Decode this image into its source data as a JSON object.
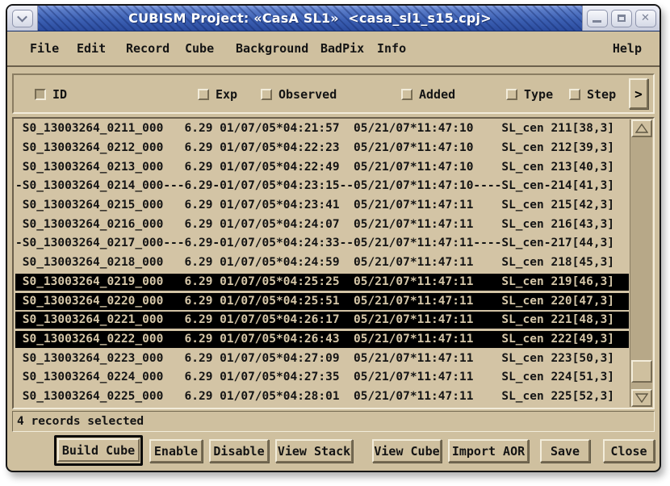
{
  "window": {
    "title": "CUBISM Project: «CasA SL1»  <casa_sl1_s15.cpj>"
  },
  "menubar": {
    "items": [
      "File",
      "Edit",
      "Record",
      "Cube",
      "Background",
      "BadPix",
      "Info"
    ],
    "help": "Help"
  },
  "header": {
    "columns": [
      {
        "label": "ID",
        "checked": true
      },
      {
        "label": "Exp",
        "checked": false
      },
      {
        "label": "Observed",
        "checked": false
      },
      {
        "label": "Added",
        "checked": false
      },
      {
        "label": "Type",
        "checked": false
      },
      {
        "label": "Step",
        "checked": false
      }
    ],
    "more_label": ">"
  },
  "list": {
    "rows": [
      {
        "id": "S0_13003264_0211_000",
        "exp": "6.29",
        "observed": "01/07/05*04:21:57",
        "added": "05/21/07*11:47:10",
        "type": "SL_cen",
        "step": "211[38,3]",
        "state": "normal"
      },
      {
        "id": "S0_13003264_0212_000",
        "exp": "6.29",
        "observed": "01/07/05*04:22:23",
        "added": "05/21/07*11:47:10",
        "type": "SL_cen",
        "step": "212[39,3]",
        "state": "normal"
      },
      {
        "id": "S0_13003264_0213_000",
        "exp": "6.29",
        "observed": "01/07/05*04:22:49",
        "added": "05/21/07*11:47:10",
        "type": "SL_cen",
        "step": "213[40,3]",
        "state": "normal"
      },
      {
        "id": "S0_13003264_0214_000",
        "exp": "6.29",
        "observed": "01/07/05*04:23:15",
        "added": "05/21/07*11:47:10",
        "type": "SL_cen",
        "step": "214[41,3]",
        "state": "disabled"
      },
      {
        "id": "S0_13003264_0215_000",
        "exp": "6.29",
        "observed": "01/07/05*04:23:41",
        "added": "05/21/07*11:47:11",
        "type": "SL_cen",
        "step": "215[42,3]",
        "state": "normal"
      },
      {
        "id": "S0_13003264_0216_000",
        "exp": "6.29",
        "observed": "01/07/05*04:24:07",
        "added": "05/21/07*11:47:11",
        "type": "SL_cen",
        "step": "216[43,3]",
        "state": "normal"
      },
      {
        "id": "S0_13003264_0217_000",
        "exp": "6.29",
        "observed": "01/07/05*04:24:33",
        "added": "05/21/07*11:47:11",
        "type": "SL_cen",
        "step": "217[44,3]",
        "state": "disabled"
      },
      {
        "id": "S0_13003264_0218_000",
        "exp": "6.29",
        "observed": "01/07/05*04:24:59",
        "added": "05/21/07*11:47:11",
        "type": "SL_cen",
        "step": "218[45,3]",
        "state": "normal"
      },
      {
        "id": "S0_13003264_0219_000",
        "exp": "6.29",
        "observed": "01/07/05*04:25:25",
        "added": "05/21/07*11:47:11",
        "type": "SL_cen",
        "step": "219[46,3]",
        "state": "selected"
      },
      {
        "id": "S0_13003264_0220_000",
        "exp": "6.29",
        "observed": "01/07/05*04:25:51",
        "added": "05/21/07*11:47:11",
        "type": "SL_cen",
        "step": "220[47,3]",
        "state": "selected"
      },
      {
        "id": "S0_13003264_0221_000",
        "exp": "6.29",
        "observed": "01/07/05*04:26:17",
        "added": "05/21/07*11:47:11",
        "type": "SL_cen",
        "step": "221[48,3]",
        "state": "selected"
      },
      {
        "id": "S0_13003264_0222_000",
        "exp": "6.29",
        "observed": "01/07/05*04:26:43",
        "added": "05/21/07*11:47:11",
        "type": "SL_cen",
        "step": "222[49,3]",
        "state": "selected"
      },
      {
        "id": "S0_13003264_0223_000",
        "exp": "6.29",
        "observed": "01/07/05*04:27:09",
        "added": "05/21/07*11:47:11",
        "type": "SL_cen",
        "step": "223[50,3]",
        "state": "normal"
      },
      {
        "id": "S0_13003264_0224_000",
        "exp": "6.29",
        "observed": "01/07/05*04:27:35",
        "added": "05/21/07*11:47:11",
        "type": "SL_cen",
        "step": "224[51,3]",
        "state": "normal"
      },
      {
        "id": "S0_13003264_0225_000",
        "exp": "6.29",
        "observed": "01/07/05*04:28:01",
        "added": "05/21/07*11:47:11",
        "type": "SL_cen",
        "step": "225[52,3]",
        "state": "normal"
      }
    ]
  },
  "status": {
    "text": "4 records selected"
  },
  "actions": {
    "build_cube": "Build Cube",
    "enable": "Enable",
    "disable": "Disable",
    "view_stack": "View Stack",
    "view_cube": "View Cube",
    "import_aor": "Import AOR",
    "save": "Save",
    "close": "Close"
  },
  "colors": {
    "frame_bg": "#cfc09f",
    "list_bg": "#d3c4a5",
    "selected_bg": "#000000",
    "selected_text": "#d6c7a8",
    "titlebar_blue": "#3d61b4",
    "bevel_light": "#f2ecda",
    "bevel_dark": "#776c54"
  }
}
